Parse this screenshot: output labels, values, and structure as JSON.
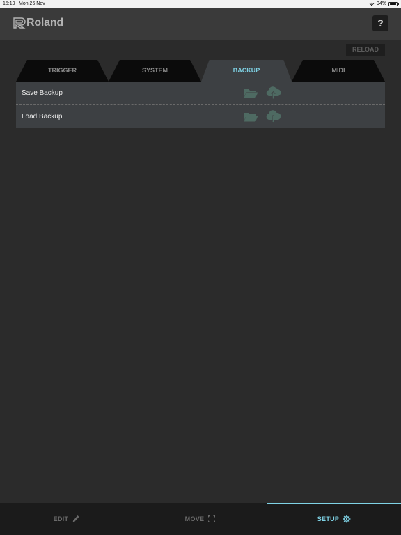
{
  "status_bar": {
    "time": "15:19",
    "date": "Mon 26 Nov",
    "battery": "94%",
    "icons": [
      "wifi-icon",
      "battery-icon"
    ]
  },
  "header": {
    "logo_text": "Roland",
    "help_label": "?"
  },
  "reload_label": "RELOAD",
  "tabs": [
    {
      "label": "TRIGGER",
      "active": false
    },
    {
      "label": "SYSTEM",
      "active": false
    },
    {
      "label": "BACKUP",
      "active": true
    },
    {
      "label": "MIDI",
      "active": false
    }
  ],
  "backup_rows": [
    {
      "label": "Save Backup",
      "icons": [
        "folder-icon",
        "cloud-upload-icon"
      ]
    },
    {
      "label": "Load Backup",
      "icons": [
        "folder-icon",
        "cloud-download-icon"
      ]
    }
  ],
  "bottom_nav": [
    {
      "label": "EDIT",
      "icon": "pencil-icon",
      "active": false
    },
    {
      "label": "MOVE",
      "icon": "move-arrows-icon",
      "active": false
    },
    {
      "label": "SETUP",
      "icon": "gear-icon",
      "active": true
    }
  ],
  "colors": {
    "accent": "#7fd3e6",
    "icon_teal": "#4e6a62",
    "background": "#2b2b2b",
    "panel": "#3d4043"
  }
}
